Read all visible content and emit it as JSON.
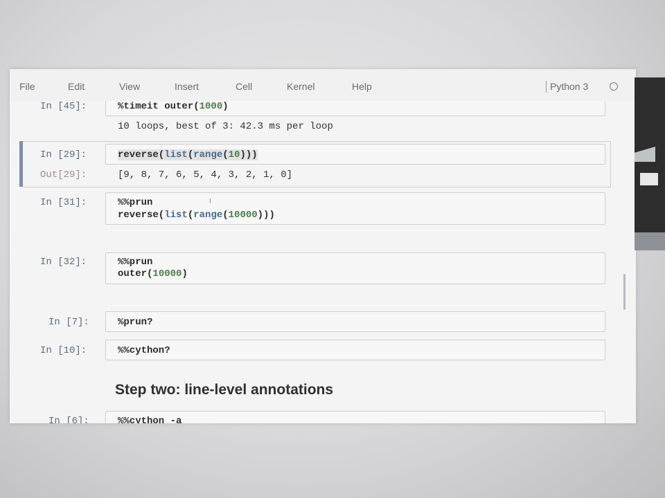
{
  "menubar": {
    "items": [
      "File",
      "Edit",
      "View",
      "Insert",
      "Cell",
      "Kernel",
      "Help"
    ],
    "kernel_name": "Python 3",
    "kernel_status_icon": "circle-icon"
  },
  "cells": [
    {
      "prompt": "In [45]:",
      "code_lines": [
        [
          {
            "t": "%timeit outer("
          },
          {
            "t": "1000",
            "c": "num"
          },
          {
            "t": ")"
          }
        ]
      ],
      "output_prompt": "",
      "output": "10 loops, best of 3: 42.3 ms per loop"
    },
    {
      "prompt": "In [29]:",
      "code_lines": [
        [
          {
            "t": "reverse("
          },
          {
            "t": "list",
            "c": "builtin"
          },
          {
            "t": "("
          },
          {
            "t": "range",
            "c": "builtin"
          },
          {
            "t": "("
          },
          {
            "t": "10",
            "c": "num"
          },
          {
            "t": ")))"
          }
        ]
      ],
      "output_prompt": "Out[29]:",
      "output": "[9, 8, 7, 6, 5, 4, 3, 2, 1, 0]",
      "selected": true
    },
    {
      "prompt": "In [31]:",
      "code_lines": [
        [
          {
            "t": "%%prun"
          }
        ],
        [
          {
            "t": "reverse("
          },
          {
            "t": "list",
            "c": "builtin"
          },
          {
            "t": "("
          },
          {
            "t": "range",
            "c": "builtin"
          },
          {
            "t": "("
          },
          {
            "t": "10000",
            "c": "num"
          },
          {
            "t": ")))"
          }
        ]
      ]
    },
    {
      "prompt": "In [32]:",
      "code_lines": [
        [
          {
            "t": "%%prun"
          }
        ],
        [
          {
            "t": "outer("
          },
          {
            "t": "10000",
            "c": "num"
          },
          {
            "t": ")"
          }
        ]
      ]
    },
    {
      "prompt": "In [7]:",
      "code_lines": [
        [
          {
            "t": "%prun?"
          }
        ]
      ]
    },
    {
      "prompt": "In [10]:",
      "code_lines": [
        [
          {
            "t": "%%cython?"
          }
        ]
      ]
    },
    {
      "prompt": "In [6]:",
      "code_lines": [
        [
          {
            "t": "%%cython -a"
          }
        ]
      ]
    }
  ],
  "heading": "Step two: line-level annotations",
  "colors": {
    "prompt_in": "#5a6c83",
    "prompt_out": "#a08c8c",
    "number": "#4f7d4f",
    "selected_bar": "#7b8fb0"
  }
}
